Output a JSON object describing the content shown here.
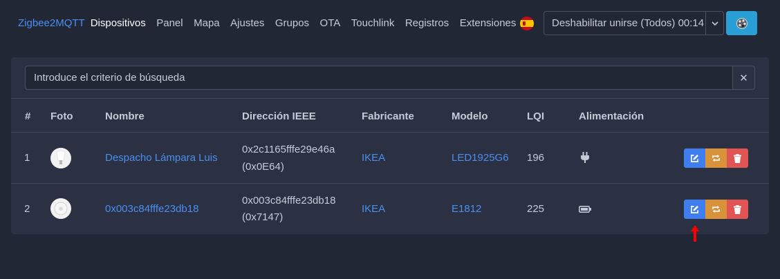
{
  "nav": {
    "brand": "Zigbee2MQTT",
    "items": [
      "Dispositivos",
      "Panel",
      "Mapa",
      "Ajustes",
      "Grupos",
      "OTA",
      "Touchlink",
      "Registros",
      "Extensiones"
    ],
    "permit_join": "Deshabilitar unirse (Todos) 00:14",
    "language_icon": "spain-flag-icon",
    "theme_icon": "palette-icon"
  },
  "search": {
    "placeholder": "Introduce el criterio de búsqueda",
    "clear_icon": "close-icon"
  },
  "table": {
    "headers": [
      "#",
      "Foto",
      "Nombre",
      "Dirección IEEE",
      "Fabricante",
      "Modelo",
      "LQI",
      "Alimentación"
    ],
    "rows": [
      {
        "index": "1",
        "photo_icon": "bulb-image",
        "name": "Despacho Lámpara Luis",
        "ieee": "0x2c1165fffe29e46a",
        "nwk": "(0x0E64)",
        "manufacturer": "IKEA",
        "model": "LED1925G6",
        "lqi": "196",
        "power_icon": "plug-icon"
      },
      {
        "index": "2",
        "photo_icon": "remote-image",
        "name": "0x003c84fffe23db18",
        "ieee": "0x003c84fffe23db18",
        "nwk": "(0x7147)",
        "manufacturer": "IKEA",
        "model": "E1812",
        "lqi": "225",
        "power_icon": "battery-icon"
      }
    ],
    "action_icons": [
      "edit-icon",
      "interview-icon",
      "delete-icon"
    ]
  },
  "colors": {
    "background": "#222736",
    "card": "#2b3142",
    "link": "#4a8ff0",
    "edit": "#3e7ef0",
    "interview": "#d8923a",
    "delete": "#e05453",
    "theme_button": "#2a9fd6",
    "annotation_arrow": "#ff0000"
  }
}
